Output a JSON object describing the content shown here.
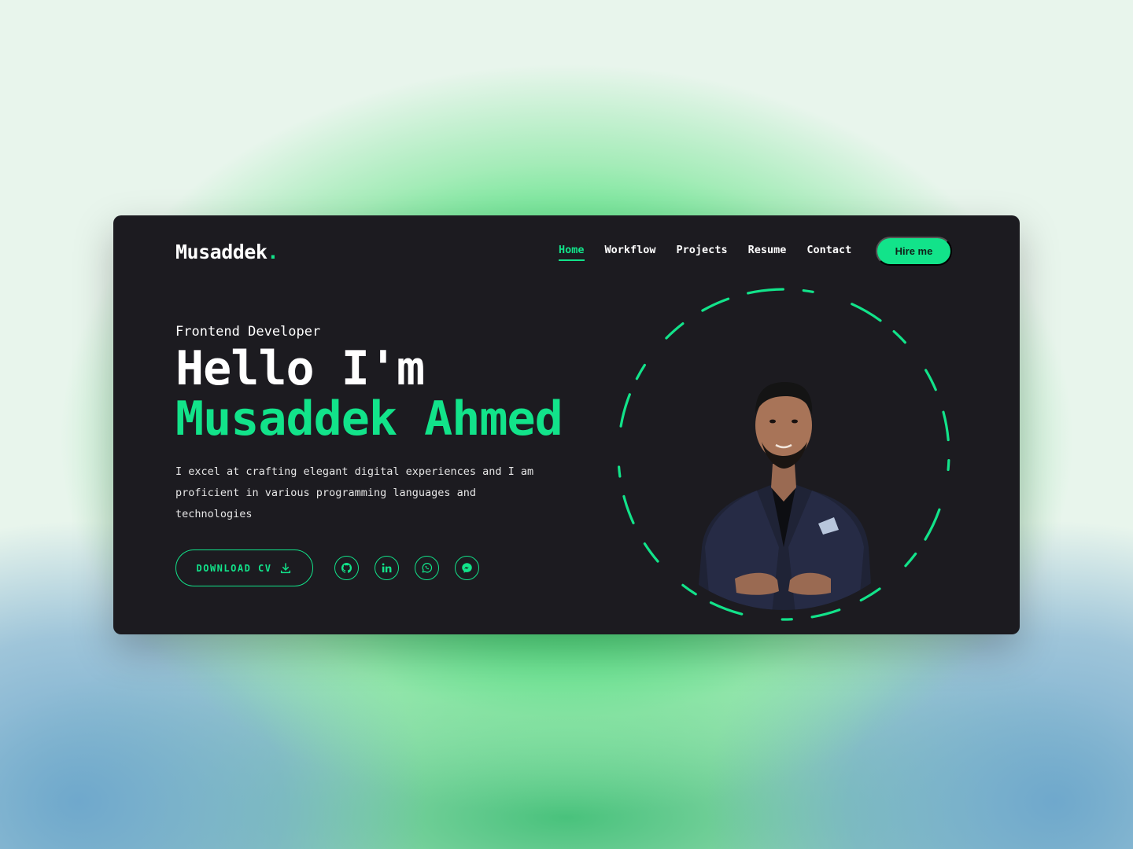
{
  "brand": {
    "name": "Musaddek",
    "dot": "."
  },
  "nav": {
    "items": [
      {
        "label": "Home",
        "active": true
      },
      {
        "label": "Workflow",
        "active": false
      },
      {
        "label": "Projects",
        "active": false
      },
      {
        "label": "Resume",
        "active": false
      },
      {
        "label": "Contact",
        "active": false
      }
    ],
    "cta_label": "Hire me"
  },
  "hero": {
    "role": "Frontend Developer",
    "greeting": "Hello I'm",
    "name": "Musaddek Ahmed",
    "description": "I excel at crafting elegant digital experiences and I am proficient in various programming languages and technologies",
    "cv_label": "DOWNLOAD CV",
    "socials": [
      "github-icon",
      "linkedin-icon",
      "whatsapp-icon",
      "messenger-icon"
    ]
  },
  "colors": {
    "accent": "#12e38a",
    "card_bg": "#1c1b20",
    "text": "#ffffff"
  }
}
